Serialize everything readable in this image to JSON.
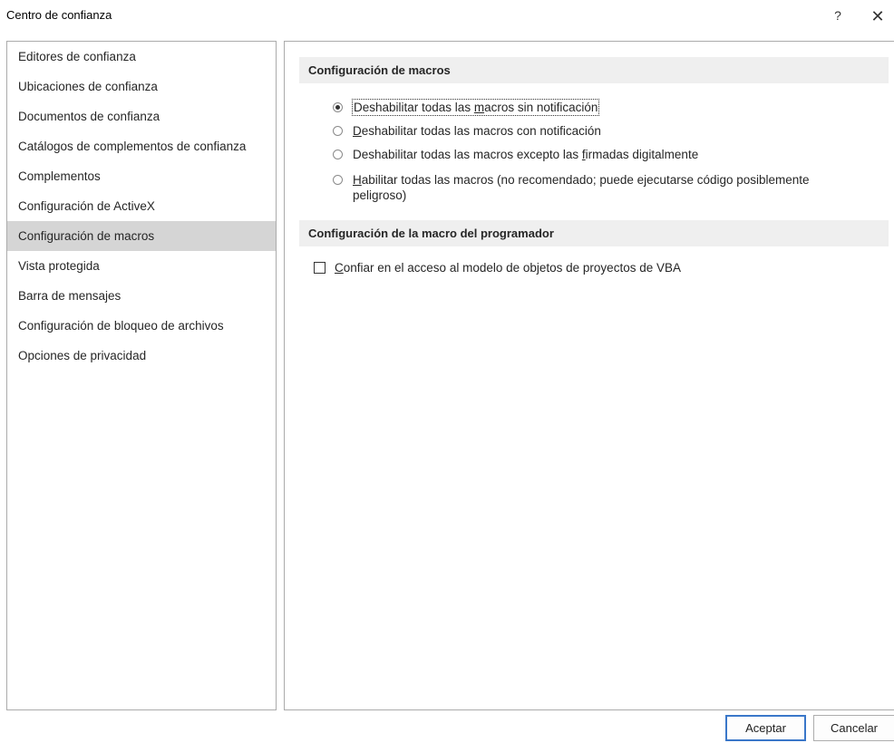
{
  "window": {
    "title": "Centro de confianza",
    "help_glyph": "?",
    "close_glyph": "✕"
  },
  "sidebar": {
    "items": [
      {
        "label": "Editores de confianza"
      },
      {
        "label": "Ubicaciones de confianza"
      },
      {
        "label": "Documentos de confianza"
      },
      {
        "label": "Catálogos de complementos de confianza"
      },
      {
        "label": "Complementos"
      },
      {
        "label": "Configuración de ActiveX"
      },
      {
        "label": "Configuración de macros",
        "selected": true
      },
      {
        "label": "Vista protegida"
      },
      {
        "label": "Barra de mensajes"
      },
      {
        "label": "Configuración de bloqueo de archivos"
      },
      {
        "label": "Opciones de privacidad"
      }
    ]
  },
  "macro_settings": {
    "header": "Configuración de macros",
    "options": [
      {
        "pre": "Deshabilitar todas las ",
        "key": "m",
        "post": "acros sin notificación",
        "selected": true
      },
      {
        "pre": "",
        "key": "D",
        "post": "eshabilitar todas las macros con notificación",
        "selected": false
      },
      {
        "pre": "Deshabilitar todas las macros excepto las ",
        "key": "f",
        "post": "irmadas digitalmente",
        "selected": false
      },
      {
        "pre": "",
        "key": "H",
        "post": "abilitar todas las macros (no recomendado; puede ejecutarse código posiblemente",
        "line2": "peligroso)",
        "selected": false
      }
    ]
  },
  "developer_settings": {
    "header": "Configuración de la macro del programador",
    "trust_vba": {
      "key": "C",
      "post": "onfiar en el acceso al modelo de objetos de proyectos de VBA",
      "checked": false
    }
  },
  "footer": {
    "ok_label": "Aceptar",
    "cancel_label": "Cancelar"
  }
}
